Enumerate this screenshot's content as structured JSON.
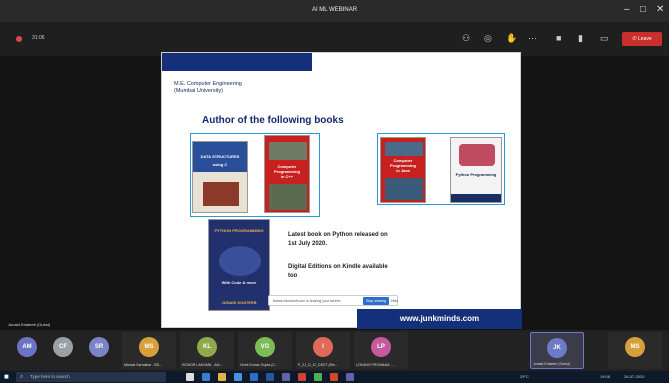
{
  "window": {
    "title": "AI ML WEBINAR",
    "controls": [
      "–",
      "□",
      "✕"
    ]
  },
  "toolbar": {
    "timer": "31:06",
    "leave_label": "Leave",
    "icons": [
      "settings-icon",
      "chat-icon",
      "people-icon",
      "more-icon",
      "camera-icon",
      "mic-icon",
      "share-icon"
    ]
  },
  "slide": {
    "dept_line1": "M.E. Computer Engineering",
    "dept_line2": "(Mumbai University)",
    "heading": "Author of the following books",
    "books": [
      {
        "title": "DATA STRUCTURES",
        "subtitle": "using C"
      },
      {
        "title": "Computer Programming",
        "subtitle": "in C++"
      },
      {
        "title": "Computer Programming",
        "subtitle": "in Java"
      },
      {
        "title": "Python Programming",
        "subtitle": ""
      },
      {
        "title": "PYTHON PROGRAMMING",
        "subtitle": "With Code & more"
      }
    ],
    "book_author": "JUNAID KHATEEB",
    "latest_text": "Latest book on Python released on 1st July 2020.",
    "digital_text": "Digital Editions on Kindle available too",
    "website": "www.junkminds.com"
  },
  "share_bar": {
    "text": "teams.microsoft.com is sharing your screen.",
    "stop_label": "Stop sharing",
    "hide_label": "Hide"
  },
  "speaker_label": "Junaid Khateeb (Guest)",
  "participants": [
    {
      "initials": "AM",
      "name": "",
      "color": "#6b74c4",
      "active": false
    },
    {
      "initials": "CF",
      "name": "",
      "color": "#9aa0a8",
      "active": false
    },
    {
      "initials": "SR",
      "name": "",
      "color": "#7b84c8",
      "active": false
    },
    {
      "initials": "MS",
      "name": "Manasi Sarnaikar - BS...",
      "color": "#d6a03a",
      "active": false
    },
    {
      "initials": "KL",
      "name": "KISHOR LAKHANI - AM...",
      "color": "#8dab4a",
      "active": false
    },
    {
      "initials": "VG",
      "name": "Vivek Kumar Gupta (C...",
      "color": "#7bbd55",
      "active": false
    },
    {
      "initials": "I",
      "name": "P_21_D_IC_DSCT (Rw...",
      "color": "#e06a5a",
      "active": false
    },
    {
      "initials": "LP",
      "name": "LOKANG PRONNAM - ...",
      "color": "#c75a9e",
      "active": false
    },
    {
      "initials": "JK",
      "name": "Junaid Khateeb (Guest)",
      "color": "#6b7bc6",
      "active": true
    },
    {
      "initials": "MS",
      "name": "",
      "color": "#d6a03a",
      "active": false
    }
  ],
  "taskbar": {
    "search_placeholder": "Type here to search",
    "time": "19:06",
    "date": "26-07-2020",
    "weather": "29°C"
  }
}
